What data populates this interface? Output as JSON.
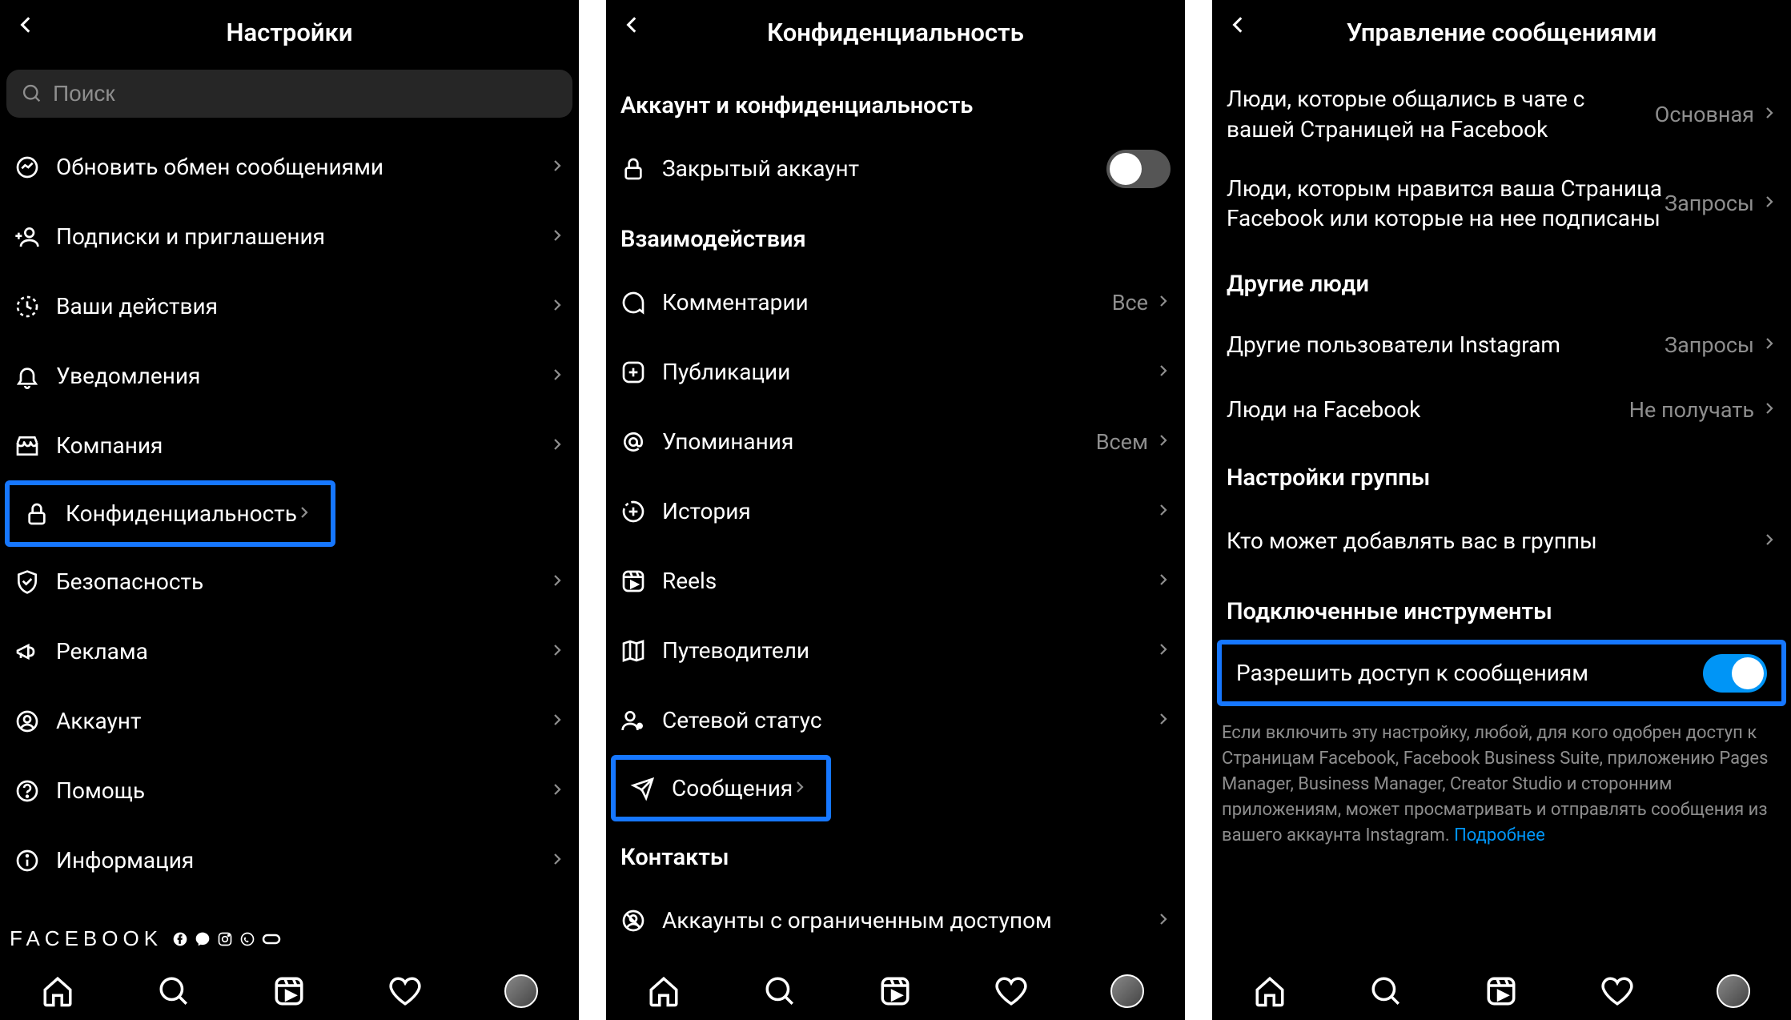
{
  "panel1": {
    "title": "Настройки",
    "search_placeholder": "Поиск",
    "items": [
      {
        "icon": "messenger",
        "label": "Обновить обмен сообщениями"
      },
      {
        "icon": "follow",
        "label": "Подписки и приглашения"
      },
      {
        "icon": "activity",
        "label": "Ваши действия"
      },
      {
        "icon": "bell",
        "label": "Уведомления"
      },
      {
        "icon": "shop",
        "label": "Компания"
      },
      {
        "icon": "lock",
        "label": "Конфиденциальность",
        "highlight": true
      },
      {
        "icon": "shield",
        "label": "Безопасность"
      },
      {
        "icon": "ads",
        "label": "Реклама"
      },
      {
        "icon": "account",
        "label": "Аккаунт"
      },
      {
        "icon": "help",
        "label": "Помощь"
      },
      {
        "icon": "info",
        "label": "Информация"
      }
    ],
    "footer_brand": "FACEBOOK"
  },
  "panel2": {
    "title": "Конфиденциальность",
    "section1": "Аккаунт и конфиденциальность",
    "private": {
      "label": "Закрытый аккаунт",
      "on": false
    },
    "section2": "Взаимодействия",
    "items": [
      {
        "icon": "comment",
        "label": "Комментарии",
        "value": "Все"
      },
      {
        "icon": "plus-box",
        "label": "Публикации"
      },
      {
        "icon": "mention",
        "label": "Упоминания",
        "value": "Всем"
      },
      {
        "icon": "story",
        "label": "История"
      },
      {
        "icon": "reels",
        "label": "Reels"
      },
      {
        "icon": "guides",
        "label": "Путеводители"
      },
      {
        "icon": "status",
        "label": "Сетевой статус"
      },
      {
        "icon": "send",
        "label": "Сообщения",
        "highlight": true
      }
    ],
    "section3": "Контакты",
    "contacts_item": {
      "icon": "restricted",
      "label": "Аккаунты с ограниченным доступом"
    }
  },
  "panel3": {
    "title": "Управление сообщениями",
    "top_items": [
      {
        "label": "Люди, которые общались в чате с вашей Страницей на Facebook",
        "value": "Основная"
      },
      {
        "label": "Люди, которым нравится ваша Страница Facebook или которые на нее подписаны",
        "value": "Запросы"
      }
    ],
    "section1": "Другие люди",
    "other_items": [
      {
        "label": "Другие пользователи Instagram",
        "value": "Запросы"
      },
      {
        "label": "Люди на Facebook",
        "value": "Не получать"
      }
    ],
    "section2": "Настройки группы",
    "group_item": {
      "label": "Кто может добавлять вас в группы"
    },
    "section3": "Подключенные инструменты",
    "allow": {
      "label": "Разрешить доступ к сообщениям",
      "on": true,
      "highlight": true
    },
    "footer_text": "Если включить эту настройку, любой, для кого одобрен доступ к Страницам Facebook, Facebook Business Suite, приложению Pages Manager, Business Manager, Creator Studio и сторонним приложениям, может просматривать и отправлять сообщения из вашего аккаунта Instagram.",
    "footer_link": "Подробнее"
  }
}
